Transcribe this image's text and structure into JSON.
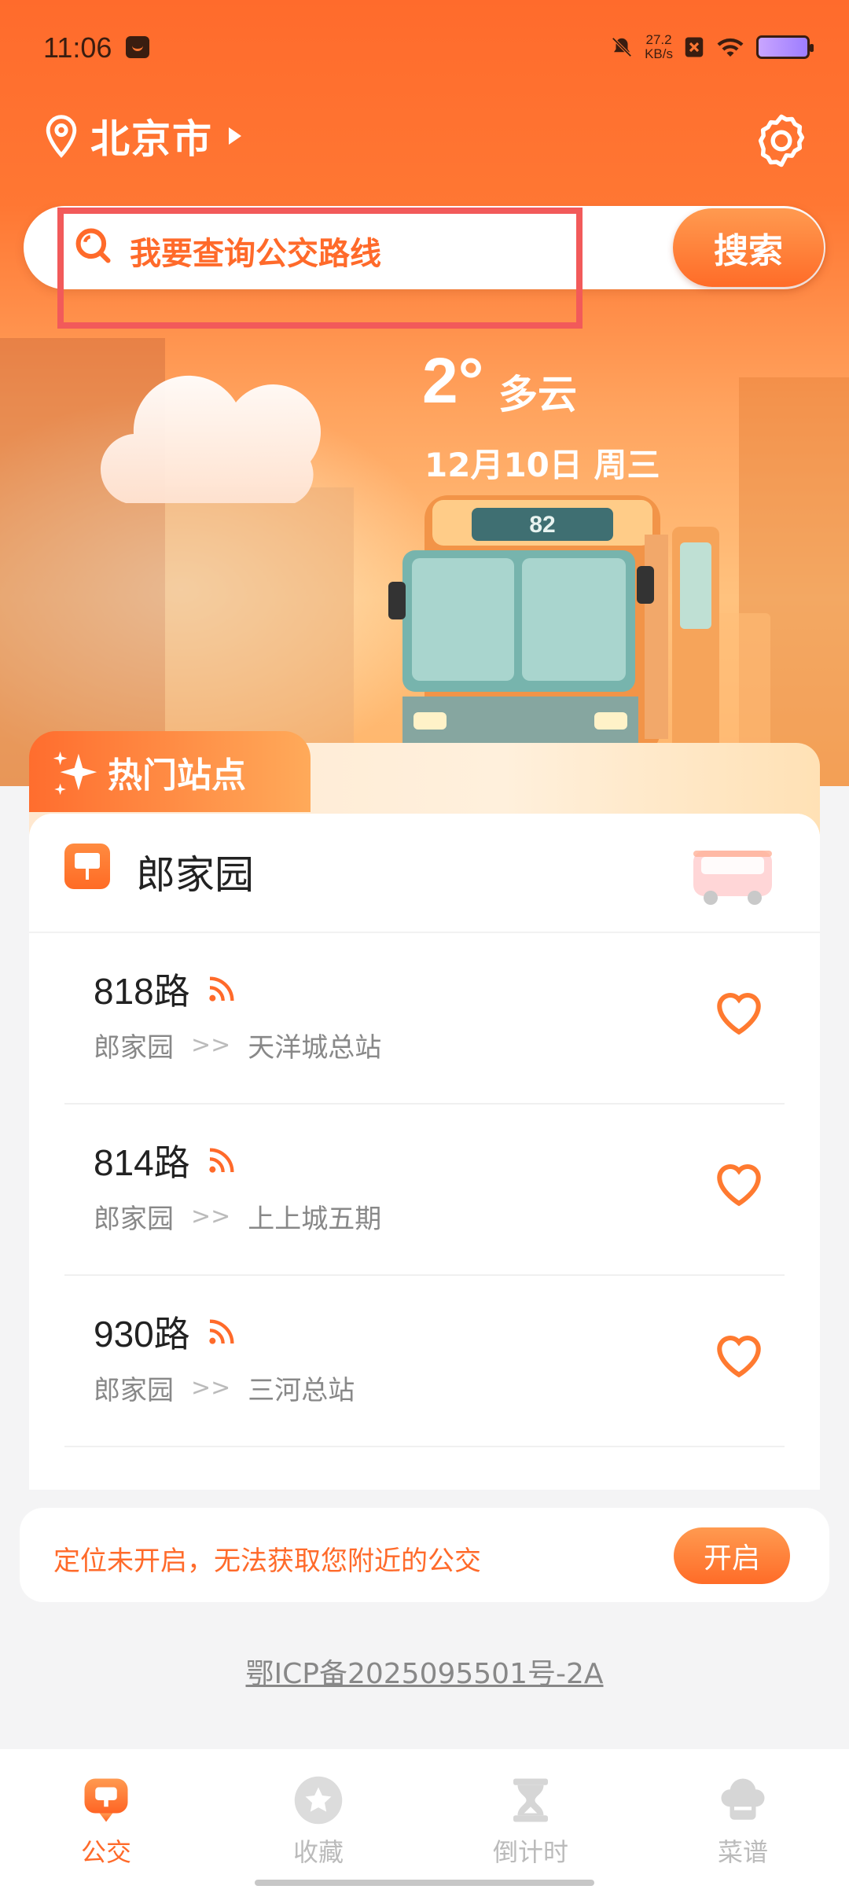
{
  "status_bar": {
    "time": "11:06",
    "net_speed_value": "27.2",
    "net_speed_unit": "KB/s"
  },
  "header": {
    "city": "北京市"
  },
  "search": {
    "placeholder": "我要查询公交路线",
    "button": "搜索"
  },
  "weather": {
    "temp": "2°",
    "condition": "多云",
    "date": "12月10日 周三"
  },
  "hero": {
    "bus_number": "82"
  },
  "hot_section": {
    "title": "热门站点",
    "station": "郎家园"
  },
  "routes": [
    {
      "name": "818路",
      "from": "郎家园",
      "sep": ">>",
      "to": "天洋城总站"
    },
    {
      "name": "814路",
      "from": "郎家园",
      "sep": ">>",
      "to": "上上城五期"
    },
    {
      "name": "930路",
      "from": "郎家园",
      "sep": ">>",
      "to": "三河总站"
    }
  ],
  "notice": {
    "text": "定位未开启，无法获取您附近的公交",
    "button": "开启"
  },
  "footer": {
    "icp": "鄂ICP备2025095501号-2A"
  },
  "tabs": [
    {
      "label": "公交",
      "icon": "bus-chat-icon",
      "active": true
    },
    {
      "label": "收藏",
      "icon": "star-icon",
      "active": false
    },
    {
      "label": "倒计时",
      "icon": "hourglass-icon",
      "active": false
    },
    {
      "label": "菜谱",
      "icon": "chef-hat-icon",
      "active": false
    }
  ],
  "colors": {
    "accent": "#ff6a2a",
    "highlight_box": "#f25a5a"
  }
}
